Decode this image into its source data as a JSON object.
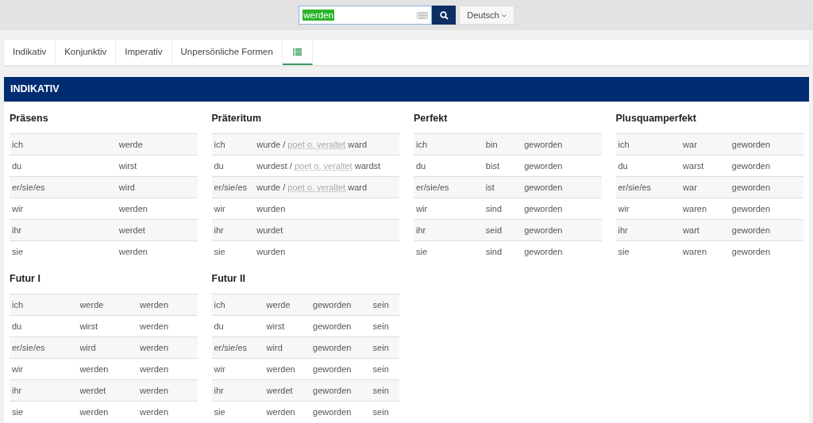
{
  "search": {
    "value": "werden",
    "selected": true
  },
  "language": {
    "label": "Deutsch"
  },
  "tabs": [
    {
      "label": "Indikativ",
      "kind": "text",
      "selected": false
    },
    {
      "label": "Konjunktiv",
      "kind": "text",
      "selected": false
    },
    {
      "label": "Imperativ",
      "kind": "text",
      "selected": false
    },
    {
      "label": "Unpersönliche Formen",
      "kind": "text",
      "selected": false
    },
    {
      "kind": "list-icon",
      "selected": true
    }
  ],
  "section": {
    "title": "INDIKATIV",
    "tenses": [
      {
        "title": "Präsens",
        "rows": [
          [
            "ich",
            "werde"
          ],
          [
            "du",
            "wirst"
          ],
          [
            "er/sie/es",
            "wird"
          ],
          [
            "wir",
            "werden"
          ],
          [
            "ihr",
            "werdet"
          ],
          [
            "sie",
            "werden"
          ]
        ]
      },
      {
        "title": "Präteritum",
        "rows": [
          [
            "ich",
            {
              "main": "wurde /",
              "note": "poet o. veraltet",
              "alt": "ward"
            }
          ],
          [
            "du",
            {
              "main": "wurdest /",
              "note": "poet o. veraltet",
              "alt": "wardst"
            }
          ],
          [
            "er/sie/es",
            {
              "main": "wurde /",
              "note": "poet o. veraltet",
              "alt": "ward"
            }
          ],
          [
            "wir",
            "wurden"
          ],
          [
            "ihr",
            "wurdet"
          ],
          [
            "sie",
            "wurden"
          ]
        ]
      },
      {
        "title": "Perfekt",
        "rows": [
          [
            "ich",
            "bin",
            "geworden"
          ],
          [
            "du",
            "bist",
            "geworden"
          ],
          [
            "er/sie/es",
            "ist",
            "geworden"
          ],
          [
            "wir",
            "sind",
            "geworden"
          ],
          [
            "ihr",
            "seid",
            "geworden"
          ],
          [
            "sie",
            "sind",
            "geworden"
          ]
        ]
      },
      {
        "title": "Plusquamperfekt",
        "rows": [
          [
            "ich",
            "war",
            "geworden"
          ],
          [
            "du",
            "warst",
            "geworden"
          ],
          [
            "er/sie/es",
            "war",
            "geworden"
          ],
          [
            "wir",
            "waren",
            "geworden"
          ],
          [
            "ihr",
            "wart",
            "geworden"
          ],
          [
            "sie",
            "waren",
            "geworden"
          ]
        ]
      },
      {
        "title": "Futur I",
        "rows": [
          [
            "ich",
            "werde",
            "werden"
          ],
          [
            "du",
            "wirst",
            "werden"
          ],
          [
            "er/sie/es",
            "wird",
            "werden"
          ],
          [
            "wir",
            "werden",
            "werden"
          ],
          [
            "ihr",
            "werdet",
            "werden"
          ],
          [
            "sie",
            "werden",
            "werden"
          ]
        ]
      },
      {
        "title": "Futur II",
        "rows": [
          [
            "ich",
            "werde",
            "geworden",
            "sein"
          ],
          [
            "du",
            "wirst",
            "geworden",
            "sein"
          ],
          [
            "er/sie/es",
            "wird",
            "geworden",
            "sein"
          ],
          [
            "wir",
            "werden",
            "geworden",
            "sein"
          ],
          [
            "ihr",
            "werdet",
            "geworden",
            "sein"
          ],
          [
            "sie",
            "werden",
            "geworden",
            "sein"
          ]
        ]
      }
    ]
  }
}
